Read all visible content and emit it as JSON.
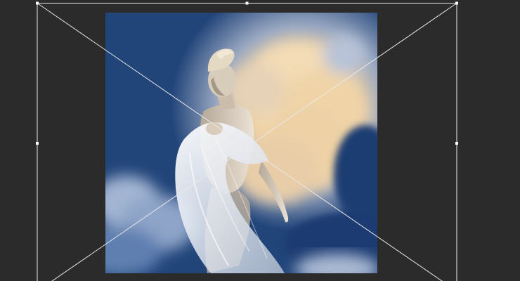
{
  "app": {
    "window_title": ""
  },
  "canvas": {
    "layer_subject": "woman-in-sheer-white-drape",
    "background_subject": "sunlit-cloud-sky",
    "colors": {
      "workspace_bg": "#2b2b2b",
      "sky_dark": "#17325f",
      "sky_mid": "#2c5594",
      "cloud_warm": "#f4dfb8",
      "cloud_soft": "#d6cbc0",
      "drape": "#e6eaf0",
      "skin": "#cfc3b4",
      "hair": "#ddd2bd"
    }
  },
  "transform_box": {
    "mode": "free-transform",
    "handles": [
      "top-left",
      "top-center",
      "top-right",
      "middle-left",
      "middle-right",
      "bottom-left",
      "bottom-center",
      "bottom-right"
    ],
    "line_color": "#e8e8e8"
  }
}
